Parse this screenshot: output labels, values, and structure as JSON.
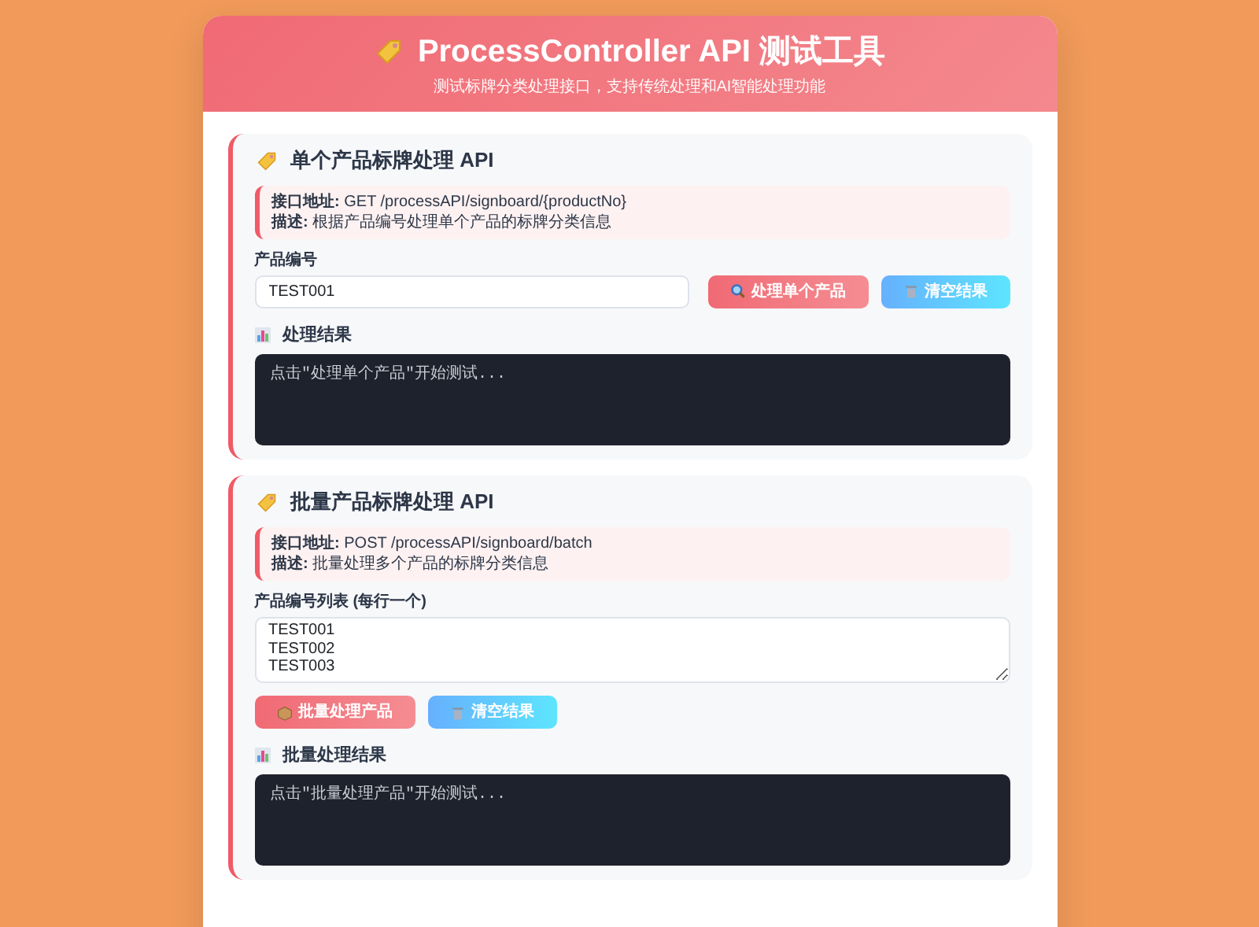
{
  "header": {
    "title": "ProcessController API 测试工具",
    "subtitle": "测试标牌分类处理接口，支持传统处理和AI智能处理功能"
  },
  "sections": [
    {
      "title": "单个产品标牌处理 API",
      "info": [
        "**接口地址:** GET /processAPI/signboard/{productNo}",
        "**描述:** 根据产品编号处理单个产品的标牌分类信息"
      ],
      "field": {
        "kind": "input",
        "label": "产品编号",
        "value": "TEST001"
      },
      "buttons": [
        {
          "kind": "process",
          "label": "处理单个产品"
        },
        {
          "kind": "clear",
          "label": "清空结果"
        }
      ],
      "result": {
        "title": "处理结果",
        "text": "点击\"处理单个产品\"开始测试..."
      }
    },
    {
      "title": "批量产品标牌处理 API",
      "info": [
        "**接口地址:** POST /processAPI/signboard/batch",
        "**描述:** 批量处理多个产品的标牌分类信息"
      ],
      "field": {
        "kind": "textarea",
        "label": "产品编号列表 (每行一个)",
        "value": "TEST001\nTEST002\nTEST003"
      },
      "buttons": [
        {
          "kind": "process",
          "label": "批量处理产品"
        },
        {
          "kind": "clear",
          "label": "清空结果"
        }
      ],
      "result": {
        "title": "批量处理结果",
        "text": "点击\"批量处理产品\"开始测试..."
      }
    }
  ]
}
